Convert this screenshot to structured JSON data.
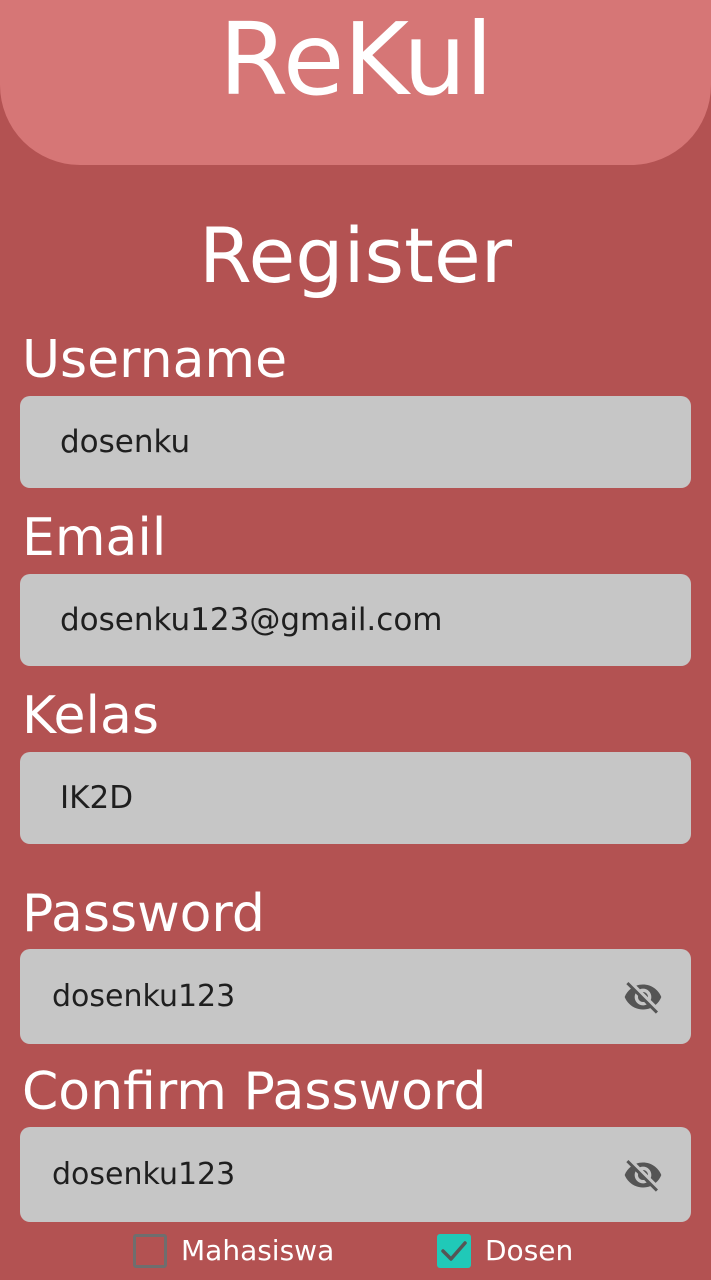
{
  "header": {
    "app_title": "ReKul"
  },
  "page": {
    "title": "Register"
  },
  "form": {
    "username": {
      "label": "Username",
      "value": "dosenku"
    },
    "email": {
      "label": "Email",
      "value": "dosenku123@gmail.com"
    },
    "kelas": {
      "label": "Kelas",
      "value": "IK2D"
    },
    "password": {
      "label": "Password",
      "value": "dosenku123",
      "toggle_icon": "eye-off-icon"
    },
    "confirm_password": {
      "label": "Confirm Password",
      "value": "dosenku123",
      "toggle_icon": "eye-off-icon"
    }
  },
  "roles": {
    "mahasiswa": {
      "label": "Mahasiswa",
      "checked": false
    },
    "dosen": {
      "label": "Dosen",
      "checked": true
    }
  },
  "colors": {
    "background": "#b35252",
    "header": "#d67676",
    "field": "#c6c6c6",
    "checkbox_checked": "#20c9b8"
  }
}
